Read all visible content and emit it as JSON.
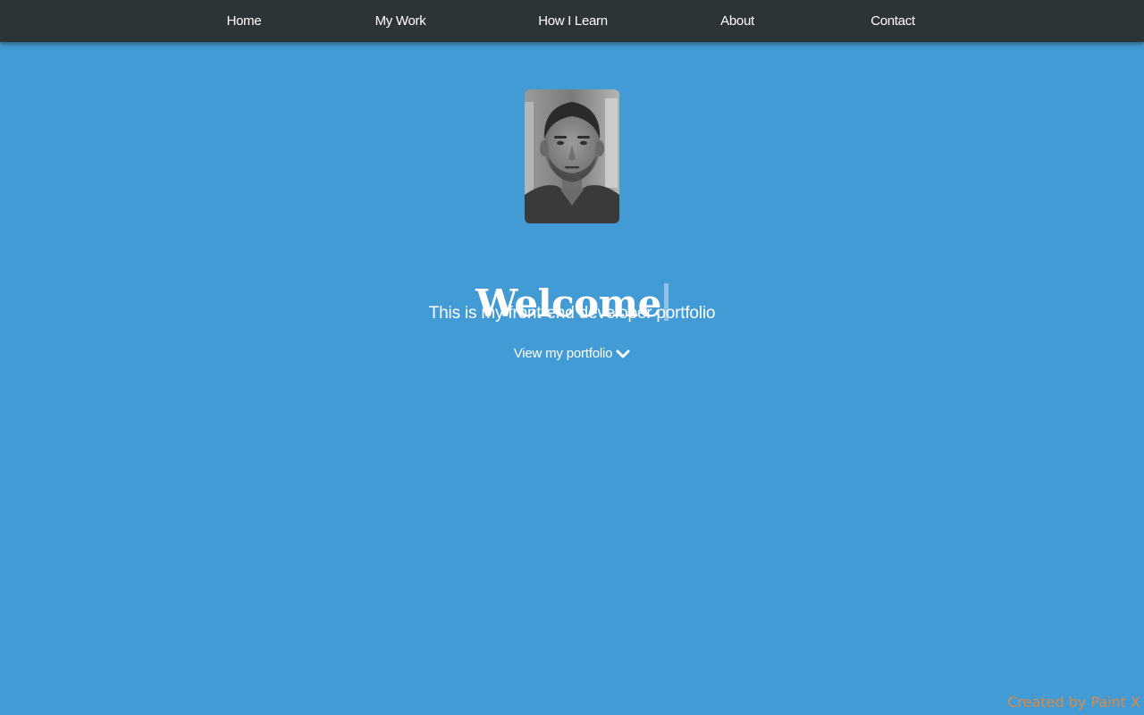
{
  "nav": {
    "items": [
      {
        "label": "Home"
      },
      {
        "label": "My Work"
      },
      {
        "label": "How I Learn"
      },
      {
        "label": "About"
      },
      {
        "label": "Contact"
      }
    ]
  },
  "hero": {
    "title": "Welcome",
    "subtitle": "This is my front-end developer portfolio",
    "cta_label": "View my portfolio",
    "cta_icon": "chevron-down-icon"
  },
  "footer": {
    "credit": "Created by Paint X"
  },
  "colors": {
    "background": "#429bd4",
    "navbar": "#2d3438",
    "text": "#ffffff",
    "credit": "#e8883a"
  }
}
